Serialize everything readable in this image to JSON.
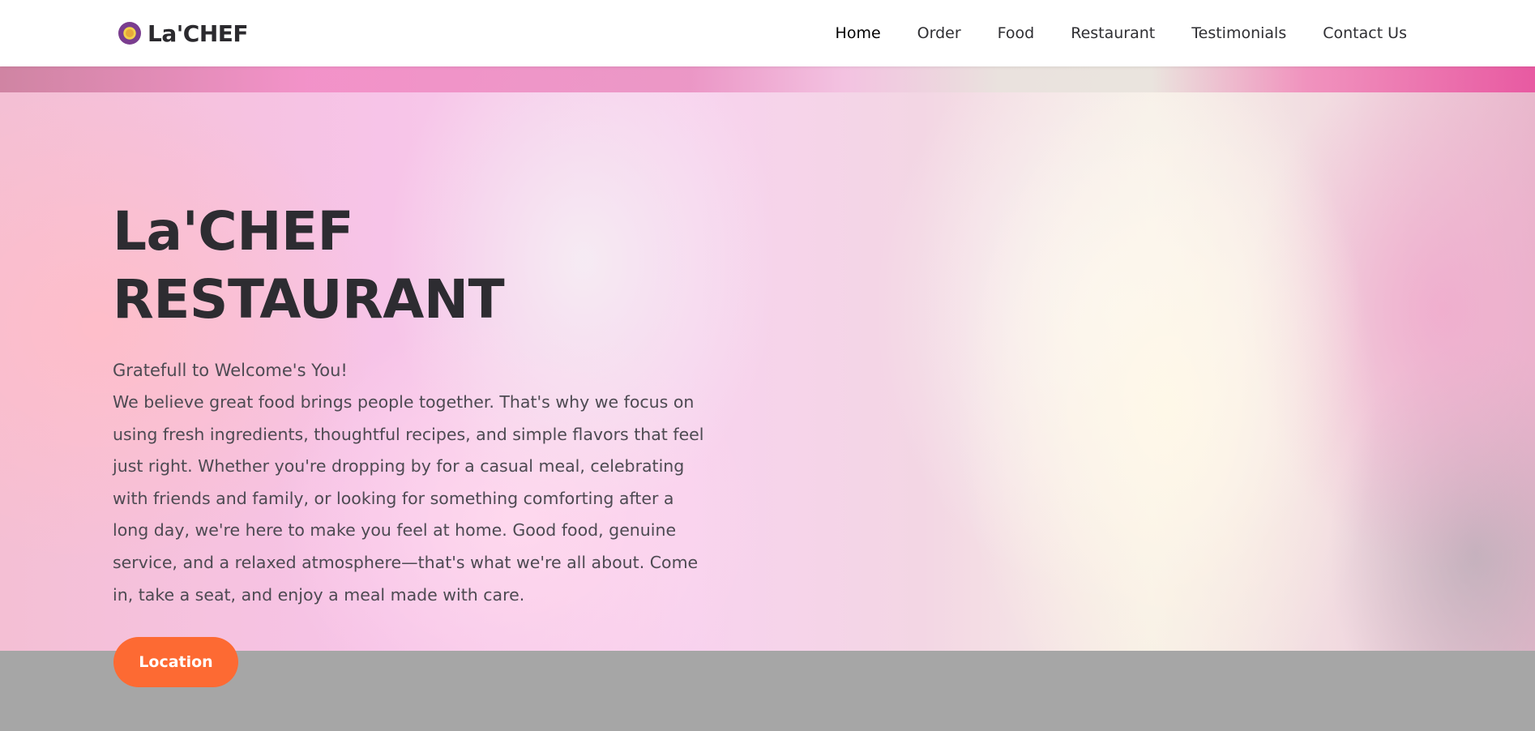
{
  "brand": {
    "name": "La'CHEF",
    "logo_icon": "chef-logo-icon"
  },
  "nav": {
    "items": [
      {
        "label": "Home",
        "active": true
      },
      {
        "label": "Order",
        "active": false
      },
      {
        "label": "Food",
        "active": false
      },
      {
        "label": "Restaurant",
        "active": false
      },
      {
        "label": "Testimonials",
        "active": false
      },
      {
        "label": "Contact Us",
        "active": false
      }
    ]
  },
  "hero": {
    "title_line1": "La'CHEF",
    "title_line2": "RESTAURANT",
    "greeting": "Gratefull to Welcome's You!",
    "description": "We believe great food brings people together. That's why we focus on using fresh ingredients, thoughtful recipes, and simple flavors that feel just right. Whether you're dropping by for a casual meal, celebrating with friends and family, or looking for something comforting after a long day, we're here to make you feel at home. Good food, genuine service, and a relaxed atmosphere—that's what we're all about. Come in, take a seat, and enjoy a meal made with care.",
    "button_label": "Location"
  },
  "colors": {
    "accent": "#fd6a33",
    "heading": "#2d2c31",
    "text": "#4d4a52",
    "footer_band": "#a6a6a6"
  }
}
